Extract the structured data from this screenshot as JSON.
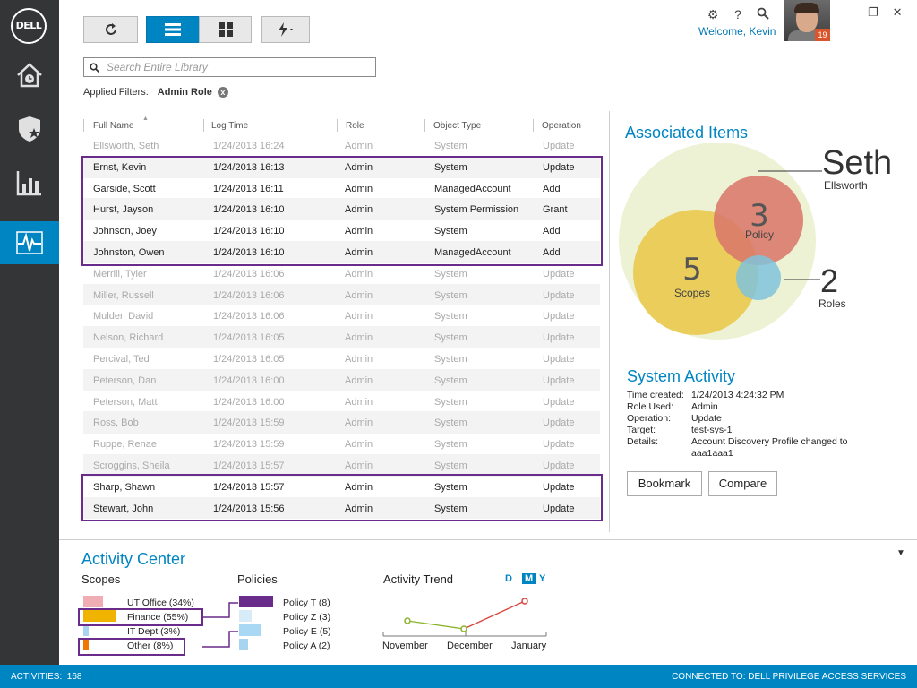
{
  "app": {
    "logo_text": "DELL",
    "welcome": "Welcome, Kevin",
    "notification_count": "19"
  },
  "toolbar": {
    "search_placeholder": "Search Entire Library",
    "applied_filters_label": "Applied Filters:",
    "filter_chip": "Admin Role",
    "filter_remove": "x"
  },
  "grid": {
    "columns": [
      "Full Name",
      "Log Time",
      "Role",
      "Object Type",
      "Operation"
    ],
    "rows": [
      {
        "name": "Ellsworth, Seth",
        "time": "1/24/2013 16:24",
        "role": "Admin",
        "type": "System",
        "op": "Update",
        "highlight": false
      },
      {
        "name": "Ernst, Kevin",
        "time": "1/24/2013 16:13",
        "role": "Admin",
        "type": "System",
        "op": "Update",
        "highlight": true
      },
      {
        "name": "Garside, Scott",
        "time": "1/24/2013 16:11",
        "role": "Admin",
        "type": "ManagedAccount",
        "op": "Add",
        "highlight": true
      },
      {
        "name": "Hurst, Jayson",
        "time": "1/24/2013 16:10",
        "role": "Admin",
        "type": "System Permission",
        "op": "Grant",
        "highlight": true
      },
      {
        "name": "Johnson, Joey",
        "time": "1/24/2013 16:10",
        "role": "Admin",
        "type": "System",
        "op": "Add",
        "highlight": true
      },
      {
        "name": "Johnston, Owen",
        "time": "1/24/2013 16:10",
        "role": "Admin",
        "type": "ManagedAccount",
        "op": "Add",
        "highlight": true
      },
      {
        "name": "Merrill, Tyler",
        "time": "1/24/2013 16:06",
        "role": "Admin",
        "type": "System",
        "op": "Update",
        "highlight": false
      },
      {
        "name": "Miller, Russell",
        "time": "1/24/2013 16:06",
        "role": "Admin",
        "type": "System",
        "op": "Update",
        "highlight": false
      },
      {
        "name": "Mulder, David",
        "time": "1/24/2013 16:06",
        "role": "Admin",
        "type": "System",
        "op": "Update",
        "highlight": false
      },
      {
        "name": "Nelson, Richard",
        "time": "1/24/2013 16:05",
        "role": "Admin",
        "type": "System",
        "op": "Update",
        "highlight": false
      },
      {
        "name": "Percival, Ted",
        "time": "1/24/2013 16:05",
        "role": "Admin",
        "type": "System",
        "op": "Update",
        "highlight": false
      },
      {
        "name": "Peterson, Dan",
        "time": "1/24/2013 16:00",
        "role": "Admin",
        "type": "System",
        "op": "Update",
        "highlight": false
      },
      {
        "name": "Peterson, Matt",
        "time": "1/24/2013 16:00",
        "role": "Admin",
        "type": "System",
        "op": "Update",
        "highlight": false
      },
      {
        "name": "Ross, Bob",
        "time": "1/24/2013 15:59",
        "role": "Admin",
        "type": "System",
        "op": "Update",
        "highlight": false
      },
      {
        "name": "Ruppe, Renae",
        "time": "1/24/2013 15:59",
        "role": "Admin",
        "type": "System",
        "op": "Update",
        "highlight": false
      },
      {
        "name": "Scroggins, Sheila",
        "time": "1/24/2013 15:57",
        "role": "Admin",
        "type": "System",
        "op": "Update",
        "highlight": false
      },
      {
        "name": "Sharp, Shawn",
        "time": "1/24/2013 15:57",
        "role": "Admin",
        "type": "System",
        "op": "Update",
        "highlight": true
      },
      {
        "name": "Stewart, John",
        "time": "1/24/2013 15:56",
        "role": "Admin",
        "type": "System",
        "op": "Update",
        "highlight": true
      }
    ]
  },
  "associated": {
    "title": "Associated Items",
    "person_first": "Seth",
    "person_last": "Ellsworth",
    "policy_count": "3",
    "policy_label": "Policy",
    "scopes_count": "5",
    "scopes_label": "Scopes",
    "roles_count": "2",
    "roles_label": "Roles"
  },
  "system_activity": {
    "title": "System Activity",
    "fields": [
      {
        "k": "Time created:",
        "v": "1/24/2013  4:24:32 PM"
      },
      {
        "k": "Role Used:",
        "v": "Admin"
      },
      {
        "k": "Operation:",
        "v": "Update"
      },
      {
        "k": "Target:",
        "v": "test-sys-1"
      },
      {
        "k": "Details:",
        "v": "Account Discovery Profile changed to"
      },
      {
        "k": "",
        "v": "aaa1aaa1"
      }
    ],
    "bookmark_label": "Bookmark",
    "compare_label": "Compare"
  },
  "activity_center": {
    "title": "Activity Center",
    "scopes_heading": "Scopes",
    "policies_heading": "Policies",
    "trend_heading": "Activity Trend",
    "scopes": [
      {
        "label": "UT Office (34%)",
        "value": 34,
        "color": "#f0aeb4"
      },
      {
        "label": "Finance (55%)",
        "value": 55,
        "color": "#f0b400"
      },
      {
        "label": "IT Dept (3%)",
        "value": 3,
        "color": "#a8d4f0"
      },
      {
        "label": "Other (8%)",
        "value": 8,
        "color": "#f07800"
      }
    ],
    "policies": [
      {
        "label": "Policy T (8)",
        "value": 8,
        "color": "#6a2c8a"
      },
      {
        "label": "Policy Z (3)",
        "value": 3,
        "color": "#d8ecf8"
      },
      {
        "label": "Policy E (5)",
        "value": 5,
        "color": "#a8d8f4"
      },
      {
        "label": "Policy A (2)",
        "value": 2,
        "color": "#a8d4f0"
      }
    ],
    "periods": [
      "D",
      "M",
      "Y"
    ],
    "selected_period": "M",
    "trend_months": [
      "November",
      "December",
      "January"
    ]
  },
  "status": {
    "activities_label": "ACTIVITIES:",
    "activities_count": "168",
    "connected": "CONNECTED TO: DELL PRIVILEGE ACCESS SERVICES"
  },
  "colors": {
    "accent": "#0085c3",
    "rail": "#333537",
    "selection": "#6a2c8a"
  }
}
